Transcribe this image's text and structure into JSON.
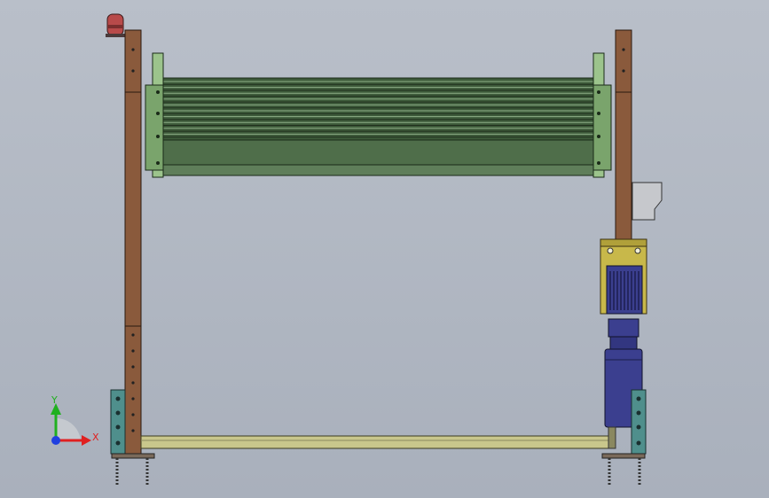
{
  "viewport": {
    "background_top": "#b9bfc9",
    "background_bottom": "#a9b0bc"
  },
  "model": {
    "frame_post_color": "#8a5a3c",
    "roller_color": "#4f6e4a",
    "side_plate_color": "#9cc48c",
    "base_rail_color": "#c9c78c",
    "motor_color": "#3b3f8f",
    "gearbox_color": "#c8b84a",
    "foot_plate_color": "#4f8f8c",
    "beacon_color": "#b84a4a"
  },
  "triad": {
    "x_label": "X",
    "y_label": "Y",
    "x_color": "#e02020",
    "y_color": "#20b020",
    "z_color": "#2040e0"
  }
}
